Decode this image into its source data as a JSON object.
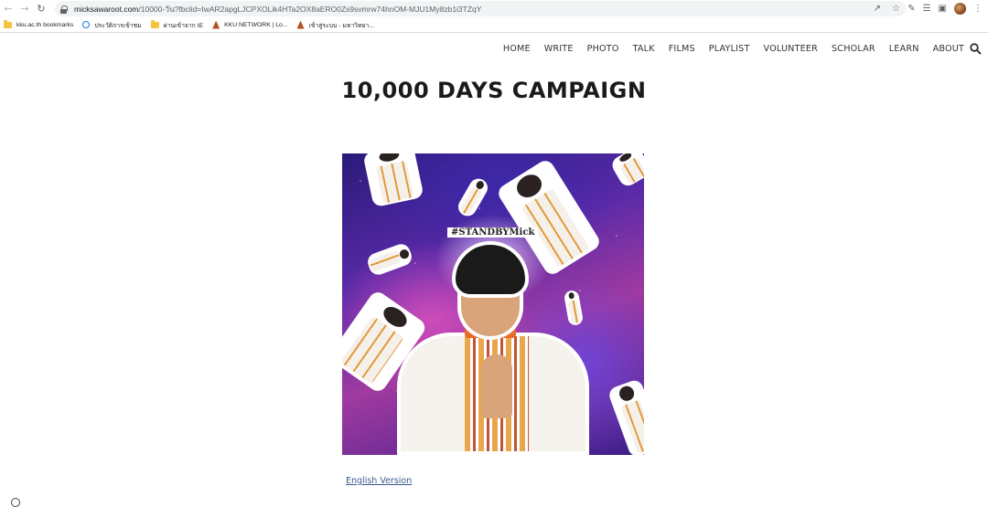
{
  "browser": {
    "url_domain": "micksawaroot.com",
    "url_path": "/10000-วัน?fbclid=IwAR2apgLJCPXOLik4HTa2OX8aERO0Zs9svmrw74hnOM-MJU1My8zb1i3TZqY",
    "nav_icons": [
      "back-arrow-icon",
      "forward-arrow-icon",
      "reload-icon"
    ],
    "bookmarks": [
      {
        "label": "kku.ac.th bookmarks",
        "icon": "folder-icon"
      },
      {
        "label": "ประวัติการเข้าชม",
        "icon": "history-icon"
      },
      {
        "label": "ผ่านเข้าจาก IE",
        "icon": "folder-icon"
      },
      {
        "label": "KKU NETWORK | Lo...",
        "icon": "kku-logo-icon"
      },
      {
        "label": "เข้าสู่ระบบ - มหาวิทยา...",
        "icon": "kku-logo-icon"
      }
    ]
  },
  "site": {
    "nav": [
      "HOME",
      "WRITE",
      "PHOTO",
      "TALK",
      "FILMS",
      "PLAYLIST",
      "VOLUNTEER",
      "SCHOLAR",
      "LEARN",
      "ABOUT"
    ],
    "title": "10,000 DAYS CAMPAIGN",
    "hero_hashtag": "#STANDBYMick",
    "english_link": "English Version"
  }
}
